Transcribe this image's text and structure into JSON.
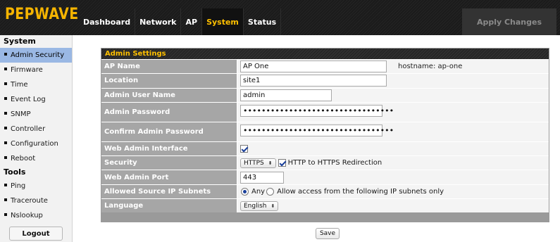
{
  "brand": {
    "logo": "PEPWAVE"
  },
  "nav": {
    "tabs": [
      {
        "label": "Dashboard"
      },
      {
        "label": "Network"
      },
      {
        "label": "AP"
      },
      {
        "label": "System"
      },
      {
        "label": "Status"
      }
    ],
    "active": "System",
    "apply_label": "Apply Changes"
  },
  "sidebar": {
    "system_heading": "System",
    "system_items": [
      {
        "label": "Admin Security"
      },
      {
        "label": "Firmware"
      },
      {
        "label": "Time"
      },
      {
        "label": "Event Log"
      },
      {
        "label": "SNMP"
      },
      {
        "label": "Controller"
      },
      {
        "label": "Configuration"
      },
      {
        "label": "Reboot"
      }
    ],
    "tools_heading": "Tools",
    "tools_items": [
      {
        "label": "Ping"
      },
      {
        "label": "Traceroute"
      },
      {
        "label": "Nslookup"
      }
    ],
    "logout_label": "Logout",
    "active_item": "Admin Security"
  },
  "admin_settings": {
    "title": "Admin Settings",
    "ap_name": {
      "label": "AP Name",
      "value": "AP One",
      "hostname_text": "hostname: ap-one"
    },
    "location": {
      "label": "Location",
      "value": "site1"
    },
    "admin_user_name": {
      "label": "Admin User Name",
      "value": "admin"
    },
    "admin_password": {
      "label": "Admin Password",
      "value": "•••••••••••••••••••••••••••••••••"
    },
    "confirm_admin_password": {
      "label": "Confirm Admin Password",
      "value": "•••••••••••••••••••••••••••••••••"
    },
    "web_admin_interface": {
      "label": "Web Admin Interface",
      "checked": true
    },
    "security": {
      "label": "Security",
      "protocol": "HTTPS",
      "redirect_checked": true,
      "redirect_label": "HTTP to HTTPS Redirection"
    },
    "web_admin_port": {
      "label": "Web Admin Port",
      "value": "443"
    },
    "allowed_source_ip_subnets": {
      "label": "Allowed Source IP Subnets",
      "option_any": "Any",
      "option_restricted": "Allow access from the following IP subnets only",
      "selected": "Any"
    },
    "language": {
      "label": "Language",
      "value": "English"
    },
    "save_label": "Save"
  },
  "colors": {
    "brand_yellow": "#f5b400",
    "active_tab_text": "#ffc000",
    "sidebar_active_bg": "#9ab8e4",
    "label_bg": "#a6a6a6"
  }
}
